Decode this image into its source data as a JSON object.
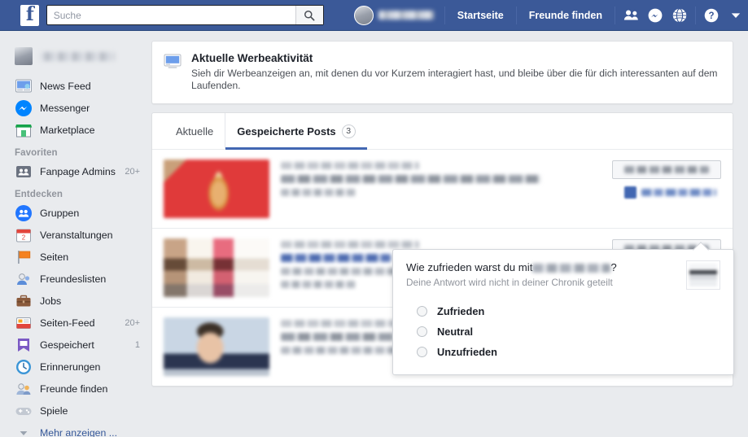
{
  "topbar": {
    "logo": "f",
    "search": {
      "placeholder": "Suche",
      "value": "",
      "icon": "search-icon"
    },
    "profile_name_redacted": "",
    "links": [
      {
        "label": "Startseite",
        "name": "home-link"
      },
      {
        "label": "Freunde finden",
        "name": "find-friends-link"
      }
    ],
    "icons": [
      {
        "name": "friend-requests-icon"
      },
      {
        "name": "messenger-icon"
      },
      {
        "name": "notifications-globe-icon"
      },
      {
        "name": "help-icon"
      },
      {
        "name": "account-chevron-down-icon"
      }
    ]
  },
  "sidebar": {
    "profile_name_redacted": "",
    "items": [
      {
        "label": "News Feed",
        "icon": "news-feed-icon",
        "badge": ""
      },
      {
        "label": "Messenger",
        "icon": "messenger-icon",
        "badge": ""
      },
      {
        "label": "Marketplace",
        "icon": "marketplace-icon",
        "badge": ""
      }
    ],
    "favorites_heading": "Favoriten",
    "favorites": [
      {
        "label": "Fanpage Admins",
        "icon": "group-icon",
        "badge": "20+"
      }
    ],
    "discover_heading": "Entdecken",
    "discover": [
      {
        "label": "Gruppen",
        "icon": "groups-icon",
        "badge": ""
      },
      {
        "label": "Veranstaltungen",
        "icon": "events-calendar-icon",
        "badge": ""
      },
      {
        "label": "Seiten",
        "icon": "pages-flag-icon",
        "badge": ""
      },
      {
        "label": "Freundeslisten",
        "icon": "friend-lists-icon",
        "badge": ""
      },
      {
        "label": "Jobs",
        "icon": "jobs-briefcase-icon",
        "badge": ""
      },
      {
        "label": "Seiten-Feed",
        "icon": "pages-feed-icon",
        "badge": "20+"
      },
      {
        "label": "Gespeichert",
        "icon": "saved-bookmark-icon",
        "badge": "1"
      },
      {
        "label": "Erinnerungen",
        "icon": "memories-clock-icon",
        "badge": ""
      },
      {
        "label": "Freunde finden",
        "icon": "find-friends-icon",
        "badge": ""
      },
      {
        "label": "Spiele",
        "icon": "games-gamepad-icon",
        "badge": ""
      }
    ],
    "show_more": "Mehr anzeigen ..."
  },
  "ad_activity": {
    "icon": "monitor-icon",
    "title": "Aktuelle Werbeaktivität",
    "description": "Sieh dir Werbeanzeigen an, mit denen du vor Kurzem interagiert hast, und bleibe über die für dich interessanten auf dem Laufenden."
  },
  "tabs": [
    {
      "label": "Aktuelle",
      "count": "",
      "active": false
    },
    {
      "label": "Gespeicherte Posts",
      "count": "3",
      "active": true
    }
  ],
  "posts": [
    {
      "thumb": "red-bottle-thumb",
      "meta_redacted": "",
      "title_redacted": "",
      "sub_redacted": "",
      "action_button_redacted": "",
      "saved_button_redacted": "",
      "saved_icon": "saved-bookmark-icon"
    },
    {
      "thumb": "bar-scene-thumb",
      "meta_redacted": "",
      "title_redacted": "",
      "sub_redacted": "",
      "action_button_redacted": "",
      "saved_button_redacted": "",
      "saved_icon": "saved-bookmark-icon"
    },
    {
      "thumb": "portrait-thumb",
      "meta_redacted": "",
      "title_redacted": "",
      "sub_redacted": "",
      "action_button_redacted": "",
      "saved_button_redacted": "",
      "saved_icon": "saved-bookmark-icon"
    }
  ],
  "survey_popup": {
    "question_prefix": "Wie zufrieden warst du mit",
    "question_brand_redacted": "",
    "question_suffix": "?",
    "subtitle": "Deine Antwort wird nicht in deiner Chronik geteilt",
    "thumb": "popup-thumb",
    "options": [
      {
        "label": "Zufrieden",
        "selected": false
      },
      {
        "label": "Neutral",
        "selected": false
      },
      {
        "label": "Unzufrieden",
        "selected": false
      }
    ]
  },
  "colors": {
    "brand_blue": "#3b5998",
    "accent_blue": "#4267b2",
    "page_bg": "#e9ebee",
    "link_blue": "#365899"
  }
}
